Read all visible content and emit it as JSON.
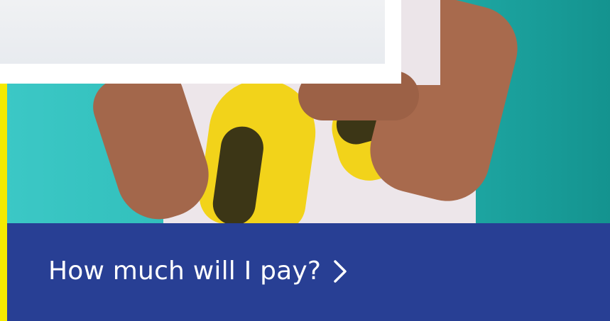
{
  "cta": {
    "label": "How much will I pay?",
    "icon": "chevron-right-icon",
    "background_color": "#283f94",
    "text_color": "#ffffff"
  },
  "hero": {
    "accent_color": "#f4ea00",
    "background_color": "#2fbdb9"
  }
}
